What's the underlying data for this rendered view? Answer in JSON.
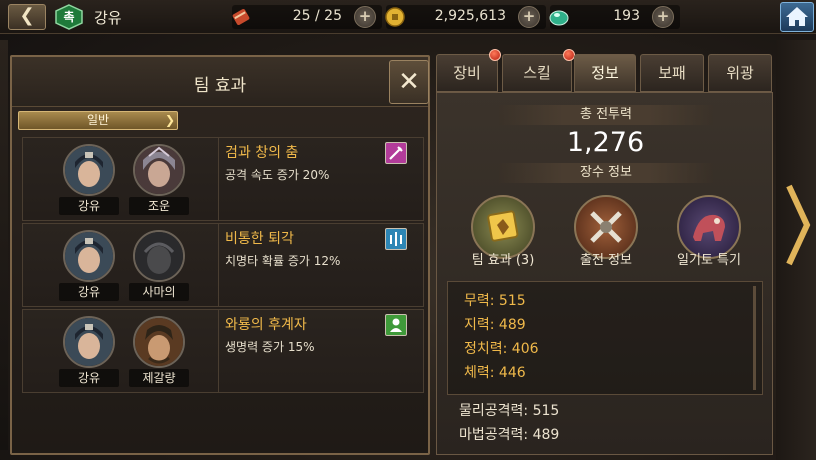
{
  "topbar": {
    "faction": "촉",
    "hero_name": "강유",
    "stamina": "25 / 25",
    "gold": "2,925,613",
    "gems": "193"
  },
  "team_panel": {
    "title": "팀 효과",
    "category_tab": "일반",
    "effects": [
      {
        "name": "검과 창의 춤",
        "desc": "공격 속도 증가 20%",
        "icon": "sword-icon",
        "icon_color": "#b23c9a",
        "heroes": [
          "강유",
          "조운"
        ]
      },
      {
        "name": "비통한 퇴각",
        "desc": "치명타 확률 증가 12%",
        "icon": "crit-icon",
        "icon_color": "#2d86b5",
        "heroes": [
          "강유",
          "사마의"
        ]
      },
      {
        "name": "와룡의 후계자",
        "desc": "생명력 증가 15%",
        "icon": "person-icon",
        "icon_color": "#3f9a3a",
        "heroes": [
          "강유",
          "제갈량"
        ]
      }
    ]
  },
  "tabs": [
    {
      "label": "장비",
      "notify": true,
      "active": false
    },
    {
      "label": "스킬",
      "notify": true,
      "active": false
    },
    {
      "label": "정보",
      "notify": false,
      "active": true
    },
    {
      "label": "보패",
      "notify": false,
      "active": false
    },
    {
      "label": "위광",
      "notify": false,
      "active": false
    }
  ],
  "info": {
    "power_label": "총 전투력",
    "power_value": "1,276",
    "general_info_label": "장수 정보",
    "buttons": [
      {
        "label": "팀 효과 (3)",
        "icon": "team-effect-icon"
      },
      {
        "label": "출전 정보",
        "icon": "crossed-swords-icon"
      },
      {
        "label": "일기토 특기",
        "icon": "cavalry-icon"
      }
    ],
    "stats": [
      "무력: 515",
      "지력: 489",
      "정치력: 406",
      "체력: 446"
    ],
    "derived_stats": [
      "물리공격력: 515",
      "마법공격력: 489"
    ]
  },
  "colors": {
    "accent_gold": "#f0b94a",
    "panel_border": "#7a6347"
  }
}
